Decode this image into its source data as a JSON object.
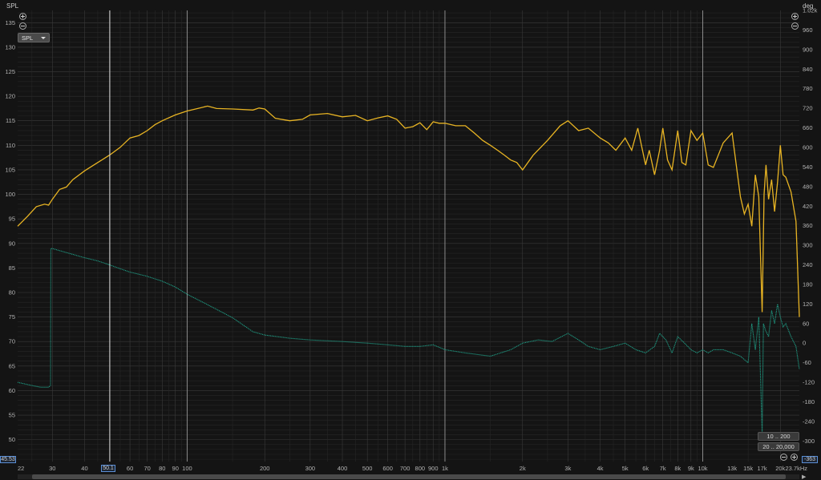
{
  "window": {
    "left_axis_unit": "SPL",
    "right_axis_unit": "deg",
    "x_axis_unit": "Hz",
    "trace_selector": "SPL",
    "cursor_x_readout": "50.1",
    "cursor_left_readout": "45.53",
    "cursor_right_readout": "-363",
    "range_button_1": "10 .. 200",
    "range_button_2": "20 .. 20,000"
  },
  "colors": {
    "background": "#141414",
    "grid_major": "#3a3a3a",
    "grid_minor": "#262626",
    "spl": "#e8b423",
    "phase": "#1f9e86",
    "cursor": "#e0e0e0"
  },
  "chart_data": {
    "type": "line",
    "x_scale": "log",
    "xlim": [
      22,
      23700
    ],
    "ylim": [
      45.53,
      137.5
    ],
    "y2lim": [
      -363,
      1020
    ],
    "grid": true,
    "cursor_x": 50.1,
    "x_ticks": [
      {
        "v": 22,
        "label": "22"
      },
      {
        "v": 30,
        "label": "30"
      },
      {
        "v": 40,
        "label": "40"
      },
      {
        "v": 60,
        "label": "60"
      },
      {
        "v": 70,
        "label": "70"
      },
      {
        "v": 80,
        "label": "80"
      },
      {
        "v": 90,
        "label": "90"
      },
      {
        "v": 100,
        "label": "100"
      },
      {
        "v": 200,
        "label": "200"
      },
      {
        "v": 300,
        "label": "300"
      },
      {
        "v": 400,
        "label": "400"
      },
      {
        "v": 500,
        "label": "500"
      },
      {
        "v": 600,
        "label": "600"
      },
      {
        "v": 700,
        "label": "700"
      },
      {
        "v": 800,
        "label": "800"
      },
      {
        "v": 900,
        "label": "900"
      },
      {
        "v": 1000,
        "label": "1k"
      },
      {
        "v": 2000,
        "label": "2k"
      },
      {
        "v": 3000,
        "label": "3k"
      },
      {
        "v": 4000,
        "label": "4k"
      },
      {
        "v": 5000,
        "label": "5k"
      },
      {
        "v": 6000,
        "label": "6k"
      },
      {
        "v": 7000,
        "label": "7k"
      },
      {
        "v": 8000,
        "label": "8k"
      },
      {
        "v": 9000,
        "label": "9k"
      },
      {
        "v": 10000,
        "label": "10k"
      },
      {
        "v": 13000,
        "label": "13k"
      },
      {
        "v": 15000,
        "label": "15k"
      },
      {
        "v": 17000,
        "label": "17k"
      },
      {
        "v": 20000,
        "label": "20k"
      },
      {
        "v": 23700,
        "label": "23.7kHz"
      }
    ],
    "y_ticks": [
      50,
      55,
      60,
      65,
      70,
      75,
      80,
      85,
      90,
      95,
      100,
      105,
      110,
      115,
      120,
      125,
      130,
      135
    ],
    "y2_ticks": [
      {
        "v": 1020,
        "label": "1.02k"
      },
      {
        "v": 960,
        "label": "960"
      },
      {
        "v": 900,
        "label": "900"
      },
      {
        "v": 840,
        "label": "840"
      },
      {
        "v": 780,
        "label": "780"
      },
      {
        "v": 720,
        "label": "720"
      },
      {
        "v": 660,
        "label": "660"
      },
      {
        "v": 600,
        "label": "600"
      },
      {
        "v": 540,
        "label": "540"
      },
      {
        "v": 480,
        "label": "480"
      },
      {
        "v": 420,
        "label": "420"
      },
      {
        "v": 360,
        "label": "360"
      },
      {
        "v": 300,
        "label": "300"
      },
      {
        "v": 240,
        "label": "240"
      },
      {
        "v": 180,
        "label": "180"
      },
      {
        "v": 120,
        "label": "120"
      },
      {
        "v": 60,
        "label": "60"
      },
      {
        "v": 0,
        "label": "0"
      },
      {
        "v": -60,
        "label": "-60"
      },
      {
        "v": -120,
        "label": "-120"
      },
      {
        "v": -180,
        "label": "-180"
      },
      {
        "v": -240,
        "label": "-240"
      },
      {
        "v": -300,
        "label": "-300"
      }
    ],
    "series": [
      {
        "axis": "left",
        "x": [
          22,
          24,
          26,
          28,
          29,
          30,
          32,
          34,
          36,
          40,
          45,
          50,
          55,
          60,
          65,
          70,
          75,
          80,
          90,
          100,
          110,
          120,
          130,
          150,
          180,
          190,
          200,
          220,
          250,
          280,
          300,
          350,
          400,
          450,
          500,
          550,
          600,
          650,
          700,
          750,
          800,
          850,
          900,
          950,
          1000,
          1100,
          1200,
          1300,
          1400,
          1500,
          1600,
          1700,
          1800,
          1900,
          2000,
          2200,
          2500,
          2800,
          3000,
          3300,
          3600,
          4000,
          4300,
          4600,
          5000,
          5300,
          5600,
          6000,
          6200,
          6500,
          6800,
          7000,
          7300,
          7600,
          8000,
          8300,
          8600,
          9000,
          9500,
          10000,
          10500,
          11000,
          12000,
          13000,
          14000,
          14500,
          15000,
          15500,
          16000,
          16500,
          17000,
          17300,
          17600,
          18000,
          18500,
          19000,
          19500,
          20000,
          20500,
          21000,
          22000,
          23000,
          23700
        ],
        "y": [
          93.5,
          95.5,
          97.5,
          98,
          97.8,
          99,
          101,
          101.5,
          103,
          104.8,
          106.5,
          108,
          109.6,
          111.5,
          112,
          113,
          114.2,
          115,
          116.2,
          117,
          117.5,
          118,
          117.5,
          117.4,
          117.2,
          117.6,
          117.4,
          115.5,
          115,
          115.3,
          116.2,
          116.5,
          115.8,
          116.1,
          115,
          115.6,
          116,
          115.3,
          113.5,
          113.8,
          114.6,
          113.2,
          114.8,
          114.5,
          114.5,
          114,
          114,
          112.5,
          111,
          110,
          109,
          108,
          107,
          106.5,
          105,
          108,
          111,
          114,
          115,
          113,
          113.5,
          111.5,
          110.5,
          109,
          111.5,
          109,
          113.5,
          106,
          109,
          104,
          109,
          113.5,
          107,
          105,
          113,
          106.5,
          106,
          113,
          111,
          112.5,
          106,
          105.5,
          110.5,
          112.5,
          99.5,
          96,
          98,
          93.5,
          104,
          99.5,
          76,
          100,
          106,
          99,
          103,
          96.5,
          102.5,
          110,
          104,
          103.5,
          100.5,
          94.5,
          75
        ]
      },
      {
        "axis": "right",
        "x": [
          22,
          25,
          27,
          28,
          29,
          29.5,
          29.6,
          30,
          35,
          40,
          45,
          50,
          55,
          60,
          70,
          80,
          90,
          100,
          120,
          150,
          180,
          200,
          250,
          300,
          400,
          500,
          600,
          700,
          800,
          900,
          1000,
          1200,
          1500,
          1800,
          2000,
          2300,
          2600,
          3000,
          3300,
          3600,
          4000,
          4500,
          5000,
          5500,
          6000,
          6500,
          6800,
          7200,
          7600,
          8000,
          8500,
          9000,
          9500,
          10000,
          10500,
          11000,
          12000,
          13000,
          14000,
          15000,
          15500,
          16000,
          16500,
          16800,
          17000,
          17200,
          17500,
          18000,
          18500,
          19000,
          19500,
          20000,
          20500,
          21000,
          22000,
          23000,
          23700
        ],
        "y": [
          -120,
          -130,
          -135,
          -135,
          -135,
          -130,
          290,
          290,
          275,
          262,
          252,
          240,
          228,
          218,
          205,
          190,
          172,
          150,
          118,
          78,
          35,
          25,
          15,
          10,
          5,
          0,
          -5,
          -10,
          -10,
          -5,
          -20,
          -30,
          -40,
          -20,
          0,
          10,
          5,
          30,
          10,
          -10,
          -20,
          -10,
          0,
          -20,
          -30,
          -10,
          30,
          10,
          -30,
          20,
          0,
          -20,
          -30,
          -20,
          -30,
          -20,
          -20,
          -30,
          -40,
          -60,
          60,
          -20,
          80,
          -140,
          -280,
          60,
          40,
          20,
          100,
          60,
          120,
          80,
          50,
          60,
          20,
          -10,
          -80
        ]
      }
    ]
  }
}
